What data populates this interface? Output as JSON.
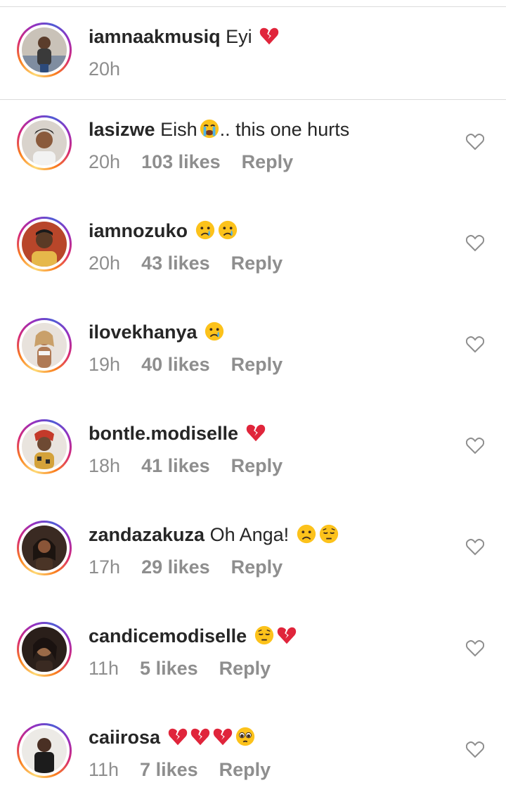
{
  "caption": {
    "username": "iamnaakmusiq",
    "text": "Eyi",
    "emojis": [
      "broken-heart"
    ],
    "time": "20h"
  },
  "comments": [
    {
      "username": "lasizwe",
      "text": "Eish",
      "emoji_after_text": [
        "loudly-crying-face"
      ],
      "text_after": ".. this one hurts",
      "time": "20h",
      "likes": "103 likes",
      "reply": "Reply"
    },
    {
      "username": "iamnozuko",
      "text": "",
      "emojis": [
        "crying-face",
        "crying-face"
      ],
      "time": "20h",
      "likes": "43 likes",
      "reply": "Reply"
    },
    {
      "username": "ilovekhanya",
      "text": "",
      "emojis": [
        "crying-face"
      ],
      "time": "19h",
      "likes": "40 likes",
      "reply": "Reply"
    },
    {
      "username": "bontle.modiselle",
      "text": "",
      "emojis": [
        "broken-heart"
      ],
      "time": "18h",
      "likes": "41 likes",
      "reply": "Reply"
    },
    {
      "username": "zandazakuza",
      "text": "Oh Anga!",
      "emojis": [
        "frowning-face",
        "pensive-face"
      ],
      "time": "17h",
      "likes": "29 likes",
      "reply": "Reply"
    },
    {
      "username": "candicemodiselle",
      "text": "",
      "emojis": [
        "pensive-face",
        "broken-heart"
      ],
      "time": "11h",
      "likes": "5 likes",
      "reply": "Reply"
    },
    {
      "username": "caiirosa",
      "text": "",
      "emojis": [
        "broken-heart",
        "broken-heart",
        "broken-heart",
        "pleading-face"
      ],
      "time": "11h",
      "likes": "7 likes",
      "reply": "Reply"
    }
  ],
  "icons": {
    "like": "heart-outline-icon"
  },
  "colors": {
    "text": "#262626",
    "meta": "#8e8e8e",
    "divider": "#dbdbdb",
    "broken_heart": "#e0253b",
    "emoji_face": "#fcc21b"
  }
}
